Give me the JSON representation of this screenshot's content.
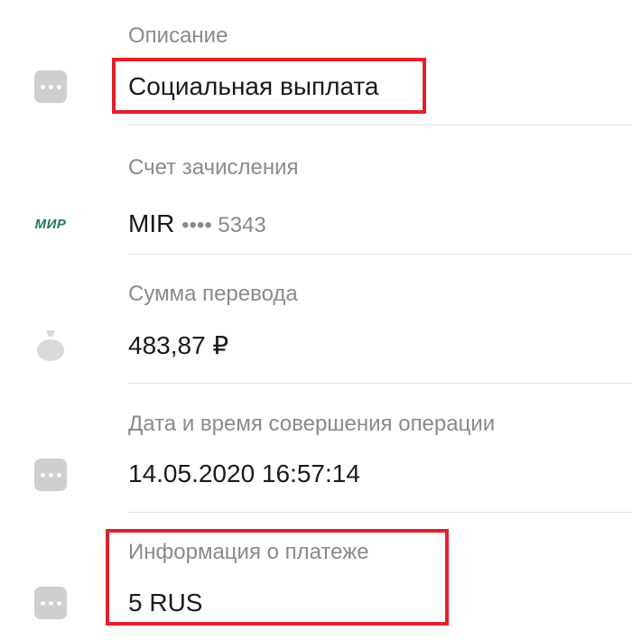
{
  "fields": [
    {
      "label": "Описание",
      "value": "Социальная выплата",
      "icon": "more-dots-icon"
    },
    {
      "label": "Счет зачисления",
      "card_system": "MIR",
      "masked": "•••• 5343",
      "icon": "mir-logo-icon",
      "icon_text": "МИР"
    },
    {
      "label": "Сумма перевода",
      "value": "483,87 ₽",
      "icon": "money-bag-icon"
    },
    {
      "label": "Дата и время совершения операции",
      "value": "14.05.2020 16:57:14",
      "icon": "more-dots-icon"
    },
    {
      "label": "Информация о платеже",
      "value": "5 RUS",
      "icon": "more-dots-icon"
    }
  ],
  "colors": {
    "highlight": "#e3202a",
    "label": "#8a8a8a",
    "value": "#1a1a1a",
    "mir": "#1e7a52",
    "icon": "#cfcfcf"
  }
}
